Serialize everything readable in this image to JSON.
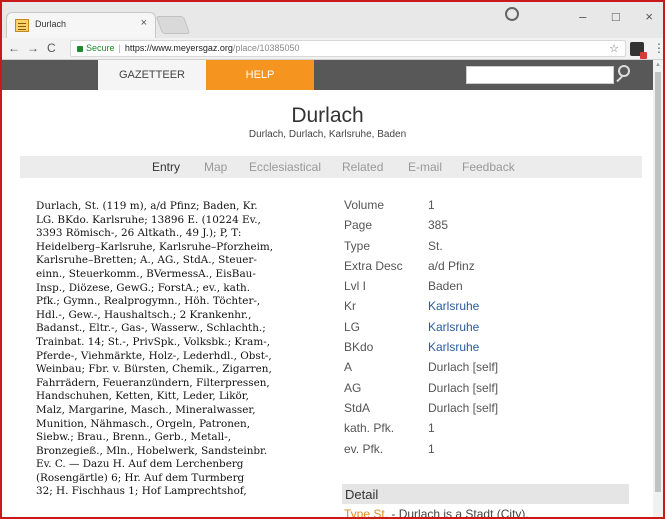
{
  "browser": {
    "tab_title": "Durlach",
    "tab_close": "×",
    "back": "←",
    "forward": "→",
    "reload": "C",
    "secure_label": "Secure",
    "url_host": "https://www.meyersgaz.org",
    "url_path": "/place/10385050",
    "star": "☆",
    "menu": "⋮",
    "window_controls": {
      "minimize": "–",
      "maximize": "□",
      "close": "×"
    }
  },
  "sitenav": {
    "gazetteer": "GAZETTEER",
    "help": "HELP",
    "search_value": ""
  },
  "heading": {
    "title": "Durlach",
    "subtitle": "Durlach, Durlach, Karlsruhe, Baden"
  },
  "subnav": {
    "tabs": [
      "Entry",
      "Map",
      "Ecclesiastical",
      "Related",
      "E-mail",
      "Feedback"
    ]
  },
  "scan_lines": [
    "Durlach, St. (119 m), a/d Pfinz; Baden, Kr.",
    "LG. BKdo. Karlsruhe; 13896 E. (10224 Ev.,",
    "3393 Römisch-, 26 Altkath., 49 J.); P, T:",
    "Heidelberg–Karlsruhe, Karlsruhe–Pforzheim,",
    "Karlsruhe–Bretten; A., AG., StdA., Steuer-",
    "einn., Steuerkomm., BVermessA., EisBau-",
    "Insp., Diözese, GewG.; ForstA.; ev., kath.",
    "Pfk.; Gymn., Realprogymn., Höh. Töchter-,",
    "Hdl.-, Gew.-, Haushaltsch.; 2 Krankenhr.,",
    "Badanst., Eltr.-, Gas-, Wasserw., Schlachth.;",
    "Trainbat. 14; St.-, PrivSpk., Volksbk.; Kram-,",
    "Pferde-, Viehmärkte, Holz-, Lederhdl., Obst-,",
    "Weinbau; Fbr. v. Bürsten, Chemik., Zigarren,",
    "Fahrrädern, Feueranzündern, Filterpressen,",
    "Handschuhen, Ketten, Kitt, Leder, Likör,",
    "Malz, Margarine, Masch., Mineralwasser,",
    "Munition, Nähmasch., Orgeln, Patronen,",
    "Siebw.; Brau., Brenn., Gerb., Metall-,",
    "Bronzegieß., Mln., Hobelwerk, Sandsteinbr.",
    "Ev. C. — Dazu H. Auf dem Lerchenberg",
    "(Rosengärtle) 6; Hr. Auf dem Turmberg",
    "32; H. Fischhaus 1; Hof Lamprechtshof,"
  ],
  "info": [
    {
      "key": "Volume",
      "value": "1",
      "link": false
    },
    {
      "key": "Page",
      "value": "385",
      "link": false
    },
    {
      "key": "Type",
      "value": "St.",
      "link": false
    },
    {
      "key": "Extra Desc",
      "value": "a/d Pfinz",
      "link": false
    },
    {
      "key": "Lvl I",
      "value": "Baden",
      "link": false
    },
    {
      "key": "Kr",
      "value": "Karlsruhe",
      "link": true
    },
    {
      "key": "LG",
      "value": "Karlsruhe",
      "link": true
    },
    {
      "key": "BKdo",
      "value": "Karlsruhe",
      "link": true
    },
    {
      "key": "A",
      "value": "Durlach [self]",
      "link": false
    },
    {
      "key": "AG",
      "value": "Durlach [self]",
      "link": false
    },
    {
      "key": "StdA",
      "value": "Durlach [self]",
      "link": false
    },
    {
      "key": "kath. Pfk.",
      "value": "1",
      "link": false
    },
    {
      "key": "ev. Pfk.",
      "value": "1",
      "link": false
    }
  ],
  "detail": {
    "heading": "Detail",
    "type_link": "Type St.",
    "text": " - Durlach is a Stadt (City)."
  },
  "colors": {
    "help_orange": "#f5941f",
    "nav_bar": "#585858",
    "link_blue": "#2a5b9c",
    "frame_red": "#c9191b"
  }
}
